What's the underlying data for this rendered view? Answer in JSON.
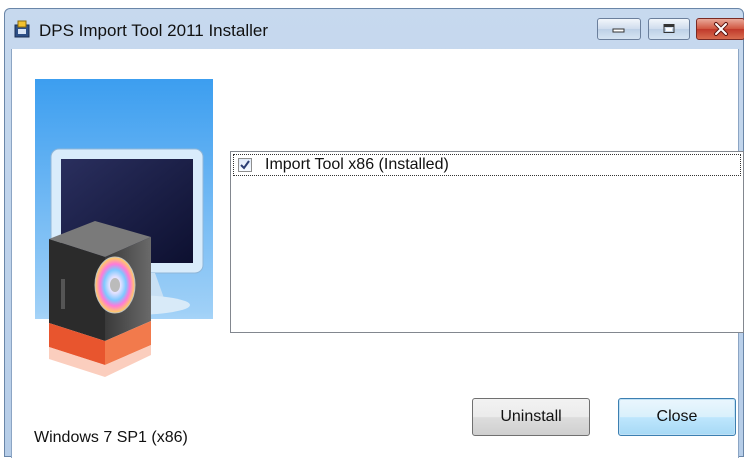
{
  "window": {
    "title": "DPS Import Tool 2011 Installer",
    "controls": [
      "minimize-icon",
      "maximize-icon",
      "close-icon"
    ]
  },
  "sidebar": {
    "image": "installer-computer-disc-illustration",
    "os_label": "Windows 7 SP1 (x86)"
  },
  "component_list": {
    "items": [
      {
        "label": "Import Tool x86  (Installed)",
        "checked": true
      }
    ]
  },
  "buttons": {
    "uninstall_label": "Uninstall",
    "close_label": "Close"
  },
  "colors": {
    "titlebar": "#c7d9ee",
    "image_sky": "#3d9ae8",
    "accent_red": "#e8552e",
    "close_button_red": "#c0392b"
  }
}
